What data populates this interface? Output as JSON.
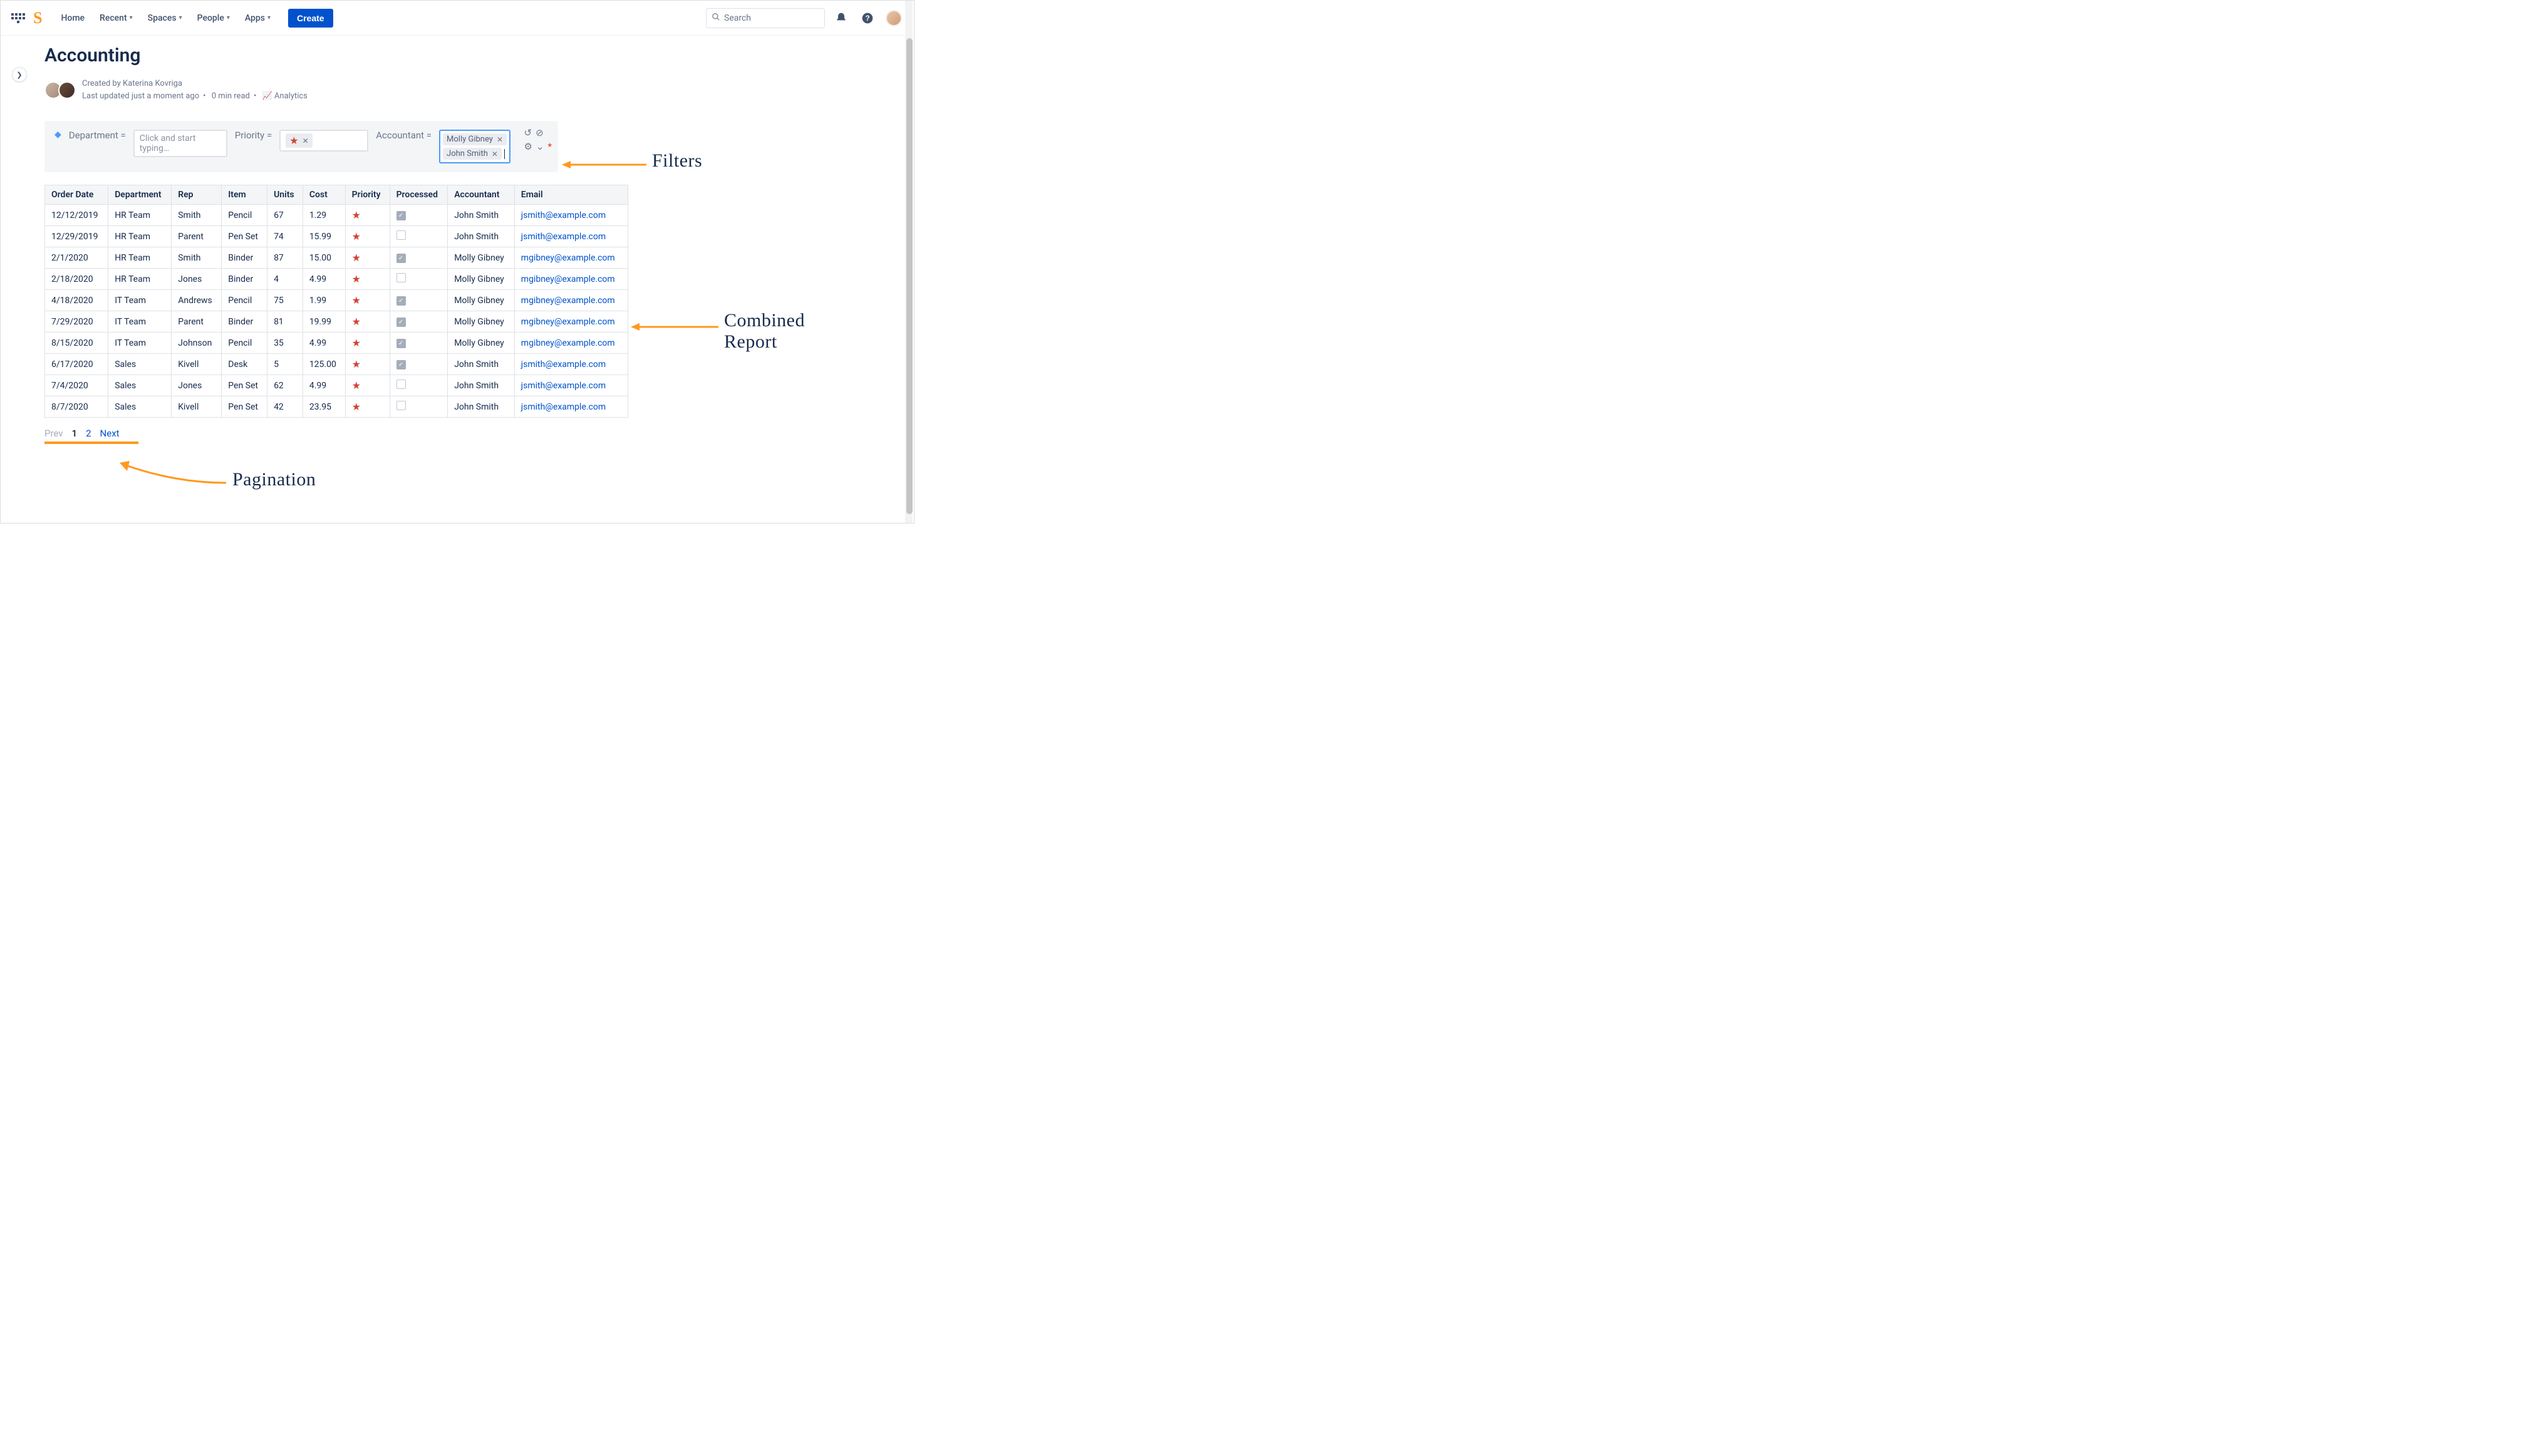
{
  "topnav": {
    "home": "Home",
    "recent": "Recent",
    "spaces": "Spaces",
    "people": "People",
    "apps": "Apps",
    "create": "Create",
    "search_placeholder": "Search"
  },
  "page": {
    "title": "Accounting",
    "created_by_prefix": "Created by ",
    "created_by": "Katerina Kovriga",
    "updated": "Last updated just a moment ago",
    "read_time": "0 min read",
    "analytics": "Analytics"
  },
  "filters": {
    "department_label": "Department =",
    "department_placeholder": "Click and start typing…",
    "priority_label": "Priority =",
    "priority_chip": "★",
    "accountant_label": "Accountant =",
    "accountant_chips": [
      "Molly Gibney",
      "John Smith"
    ]
  },
  "table": {
    "headers": [
      "Order Date",
      "Department",
      "Rep",
      "Item",
      "Units",
      "Cost",
      "Priority",
      "Processed",
      "Accountant",
      "Email"
    ],
    "rows": [
      {
        "date": "12/12/2019",
        "dept": "HR Team",
        "rep": "Smith",
        "item": "Pencil",
        "units": "67",
        "cost": "1.29",
        "priority": "★",
        "processed": true,
        "acct": "John Smith",
        "email": "jsmith@example.com"
      },
      {
        "date": "12/29/2019",
        "dept": "HR Team",
        "rep": "Parent",
        "item": "Pen Set",
        "units": "74",
        "cost": "15.99",
        "priority": "★",
        "processed": false,
        "acct": "John Smith",
        "email": "jsmith@example.com"
      },
      {
        "date": "2/1/2020",
        "dept": "HR Team",
        "rep": "Smith",
        "item": "Binder",
        "units": "87",
        "cost": "15.00",
        "priority": "★",
        "processed": true,
        "acct": "Molly Gibney",
        "email": "mgibney@example.com"
      },
      {
        "date": "2/18/2020",
        "dept": "HR Team",
        "rep": "Jones",
        "item": "Binder",
        "units": "4",
        "cost": "4.99",
        "priority": "★",
        "processed": false,
        "acct": "Molly Gibney",
        "email": "mgibney@example.com"
      },
      {
        "date": "4/18/2020",
        "dept": "IT Team",
        "rep": "Andrews",
        "item": "Pencil",
        "units": "75",
        "cost": "1.99",
        "priority": "★",
        "processed": true,
        "acct": "Molly Gibney",
        "email": "mgibney@example.com"
      },
      {
        "date": "7/29/2020",
        "dept": "IT Team",
        "rep": "Parent",
        "item": "Binder",
        "units": "81",
        "cost": "19.99",
        "priority": "★",
        "processed": true,
        "acct": "Molly Gibney",
        "email": "mgibney@example.com"
      },
      {
        "date": "8/15/2020",
        "dept": "IT Team",
        "rep": "Johnson",
        "item": "Pencil",
        "units": "35",
        "cost": "4.99",
        "priority": "★",
        "processed": true,
        "acct": "Molly Gibney",
        "email": "mgibney@example.com"
      },
      {
        "date": "6/17/2020",
        "dept": "Sales",
        "rep": "Kivell",
        "item": "Desk",
        "units": "5",
        "cost": "125.00",
        "priority": "★",
        "processed": true,
        "acct": "John Smith",
        "email": "jsmith@example.com"
      },
      {
        "date": "7/4/2020",
        "dept": "Sales",
        "rep": "Jones",
        "item": "Pen Set",
        "units": "62",
        "cost": "4.99",
        "priority": "★",
        "processed": false,
        "acct": "John Smith",
        "email": "jsmith@example.com"
      },
      {
        "date": "8/7/2020",
        "dept": "Sales",
        "rep": "Kivell",
        "item": "Pen Set",
        "units": "42",
        "cost": "23.95",
        "priority": "★",
        "processed": false,
        "acct": "John Smith",
        "email": "jsmith@example.com"
      }
    ]
  },
  "pagination": {
    "prev": "Prev",
    "p1": "1",
    "p2": "2",
    "next": "Next"
  },
  "annotations": {
    "filters": "Filters",
    "report": "Combined\nReport",
    "pagination": "Pagination"
  }
}
